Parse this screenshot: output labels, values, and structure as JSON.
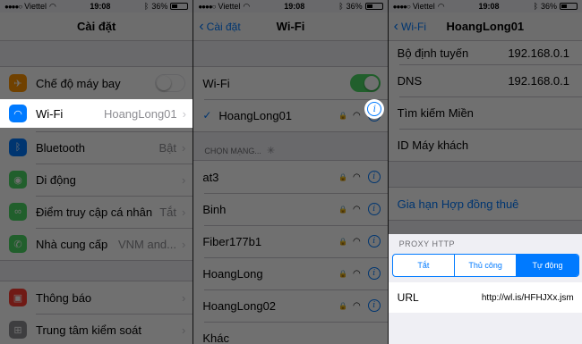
{
  "status": {
    "carrier": "Viettel",
    "time": "19:08",
    "battery": "36%"
  },
  "panel1": {
    "title": "Cài đặt",
    "rows": [
      {
        "label": "Chế độ máy bay",
        "value": "",
        "icon_color": "#ff9500",
        "icon": "airplane-icon",
        "glyph": "✈"
      },
      {
        "label": "Wi-Fi",
        "value": "HoangLong01",
        "icon_color": "#007aff",
        "icon": "wifi-icon",
        "glyph": "≈"
      },
      {
        "label": "Bluetooth",
        "value": "Bật",
        "icon_color": "#007aff",
        "icon": "bluetooth-icon",
        "glyph": "ᛒ"
      },
      {
        "label": "Di động",
        "value": "",
        "icon_color": "#4cd964",
        "icon": "cellular-icon",
        "glyph": "📶"
      },
      {
        "label": "Điểm truy cập cá nhân",
        "value": "Tắt",
        "icon_color": "#4cd964",
        "icon": "hotspot-icon",
        "glyph": "∞"
      },
      {
        "label": "Nhà cung cấp",
        "value": "VNM and...",
        "icon_color": "#4cd964",
        "icon": "phone-icon",
        "glyph": "✆"
      }
    ],
    "rows2": [
      {
        "label": "Thông báo",
        "icon_color": "#ff3b30",
        "icon": "notifications-icon",
        "glyph": "▣"
      },
      {
        "label": "Trung tâm kiểm soát",
        "icon_color": "#8e8e93",
        "icon": "control-center-icon",
        "glyph": "⊞"
      }
    ]
  },
  "panel2": {
    "back": "Cài đặt",
    "title": "Wi-Fi",
    "wifi_label": "Wi-Fi",
    "connected": "HoangLong01",
    "section": "CHỌN MẠNG...",
    "networks": [
      "at3",
      "Binh",
      "Fiber177b1",
      "HoangLong",
      "HoangLong02",
      "Khác"
    ]
  },
  "panel3": {
    "back": "Wi-Fi",
    "title": "HoangLong01",
    "router_label": "Bộ định tuyến",
    "router_value": "192.168.0.1",
    "dns_label": "DNS",
    "dns_value": "192.168.0.1",
    "search_label": "Tìm kiếm Miền",
    "client_label": "ID Máy khách",
    "renew_label": "Gia hạn Hợp đồng thuê",
    "proxy_title": "PROXY HTTP",
    "proxy_options": [
      "Tắt",
      "Thủ công",
      "Tự động"
    ],
    "url_label": "URL",
    "url_value": "http://wl.is/HFHJXx.jsm"
  },
  "colors": {
    "accent": "#007aff",
    "toggle_on": "#4cd964"
  }
}
